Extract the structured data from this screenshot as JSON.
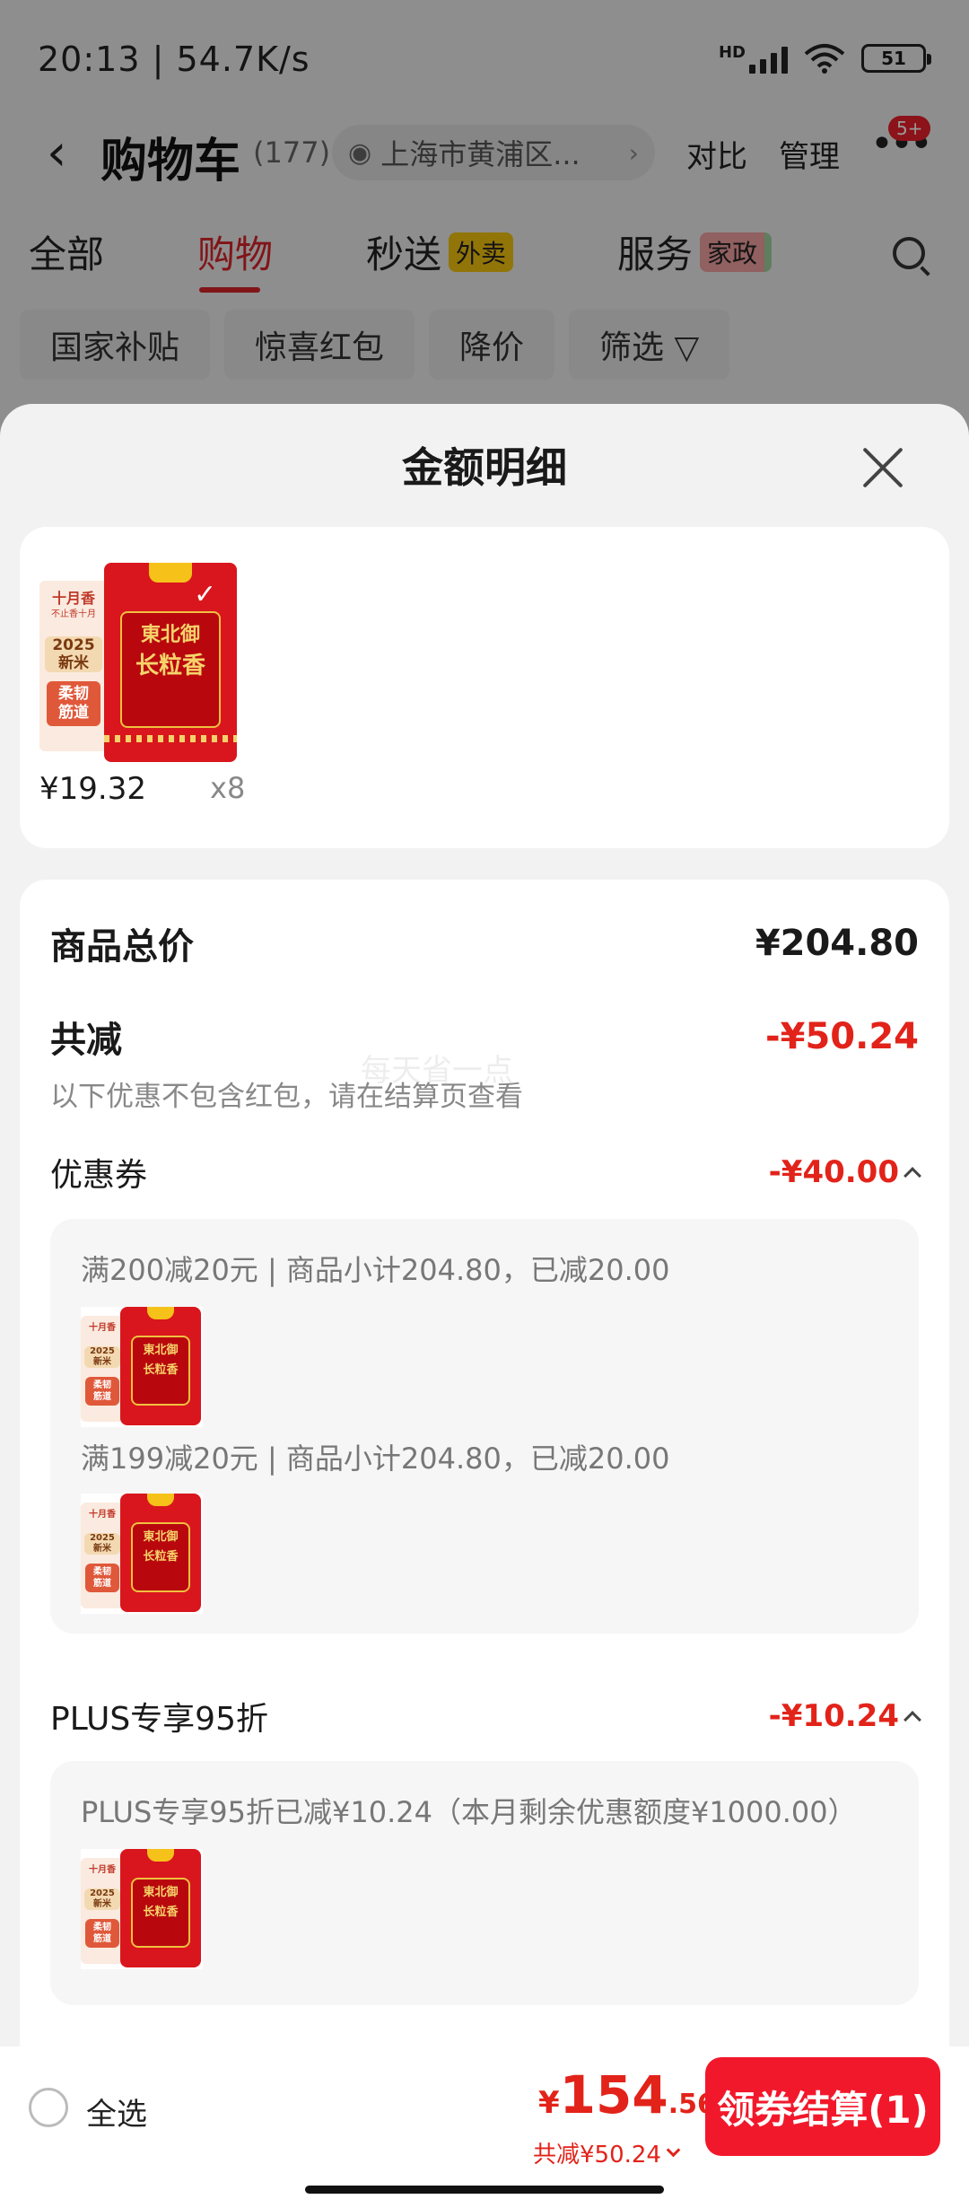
{
  "status": {
    "time": "20:13 | 54.7K/s",
    "net_label": "HD",
    "battery": "51"
  },
  "nav": {
    "title": "购物车",
    "count": "(177)",
    "location": "上海市黄浦区...",
    "compare": "对比",
    "manage": "管理",
    "badge": "5+"
  },
  "tabs": [
    {
      "label": "全部"
    },
    {
      "label": "购物"
    },
    {
      "label": "秒送",
      "tag": "外卖"
    },
    {
      "label": "服务",
      "tag": "家政"
    }
  ],
  "chips": [
    "国家补贴",
    "惊喜红包",
    "降价",
    "筛选 ▽"
  ],
  "sheet": {
    "title": "金额明细"
  },
  "rice_art": {
    "brand": "東北御",
    "name": "长粒香",
    "side_top": "十月香",
    "side_sub": "不止香十月",
    "year": "2025",
    "new": "新米",
    "soft1": "柔韧",
    "soft2": "筋道"
  },
  "product": {
    "price": "¥19.32",
    "qty": "x8"
  },
  "detail": {
    "total_label": "商品总价",
    "total_value": "¥204.80",
    "discount_label": "共减",
    "discount_value": "-¥50.24",
    "note": "以下优惠不包含红包，请在结算页查看",
    "watermark": "每天省一点",
    "coupon_label": "优惠券",
    "coupon_value": "-¥40.00",
    "coupons": [
      "满200减20元 | 商品小计204.80，已减20.00",
      "满199减20元 | 商品小计204.80，已减20.00"
    ],
    "plus_label": "PLUS专享95折",
    "plus_value": "-¥10.24",
    "plus_line": "PLUS专享95折已减¥10.24（本月剩余优惠额度¥1000.00）"
  },
  "bottom": {
    "select_all": "全选",
    "currency": "¥",
    "total_int": "154",
    "total_dec": ".56",
    "saved": "共减¥50.24",
    "checkout": "领券结算(1)"
  }
}
